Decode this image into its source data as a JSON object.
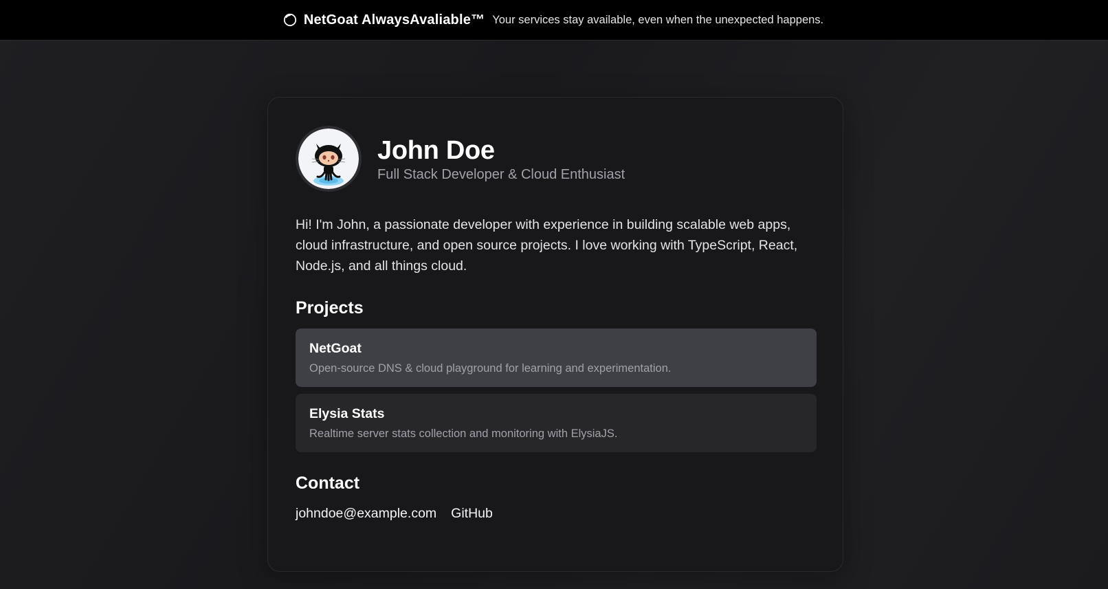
{
  "banner": {
    "icon": "loading-ring-icon",
    "title": "NetGoat AlwaysAvaliable™",
    "text": "Your services stay available, even when the unexpected happens."
  },
  "profile": {
    "avatar_icon": "octocat-avatar",
    "name": "John Doe",
    "subtitle": "Full Stack Developer & Cloud Enthusiast",
    "bio": "Hi! I'm John, a passionate developer with experience in building scalable web apps, cloud infrastructure, and open source projects. I love working with TypeScript, React, Node.js, and all things cloud."
  },
  "projects": {
    "title": "Projects",
    "items": [
      {
        "name": "NetGoat",
        "description": "Open-source DNS & cloud playground for learning and experimentation."
      },
      {
        "name": "Elysia Stats",
        "description": "Realtime server stats collection and monitoring with ElysiaJS."
      }
    ]
  },
  "contact": {
    "title": "Contact",
    "email": "johndoe@example.com",
    "github": "GitHub"
  },
  "colors": {
    "banner_bg": "#000000",
    "page_bg": "#1c1c1f",
    "card_bg": "#18181b",
    "project_hover": "#3f3f46",
    "project_bg": "#27272a",
    "muted_text": "#a1a1aa"
  }
}
